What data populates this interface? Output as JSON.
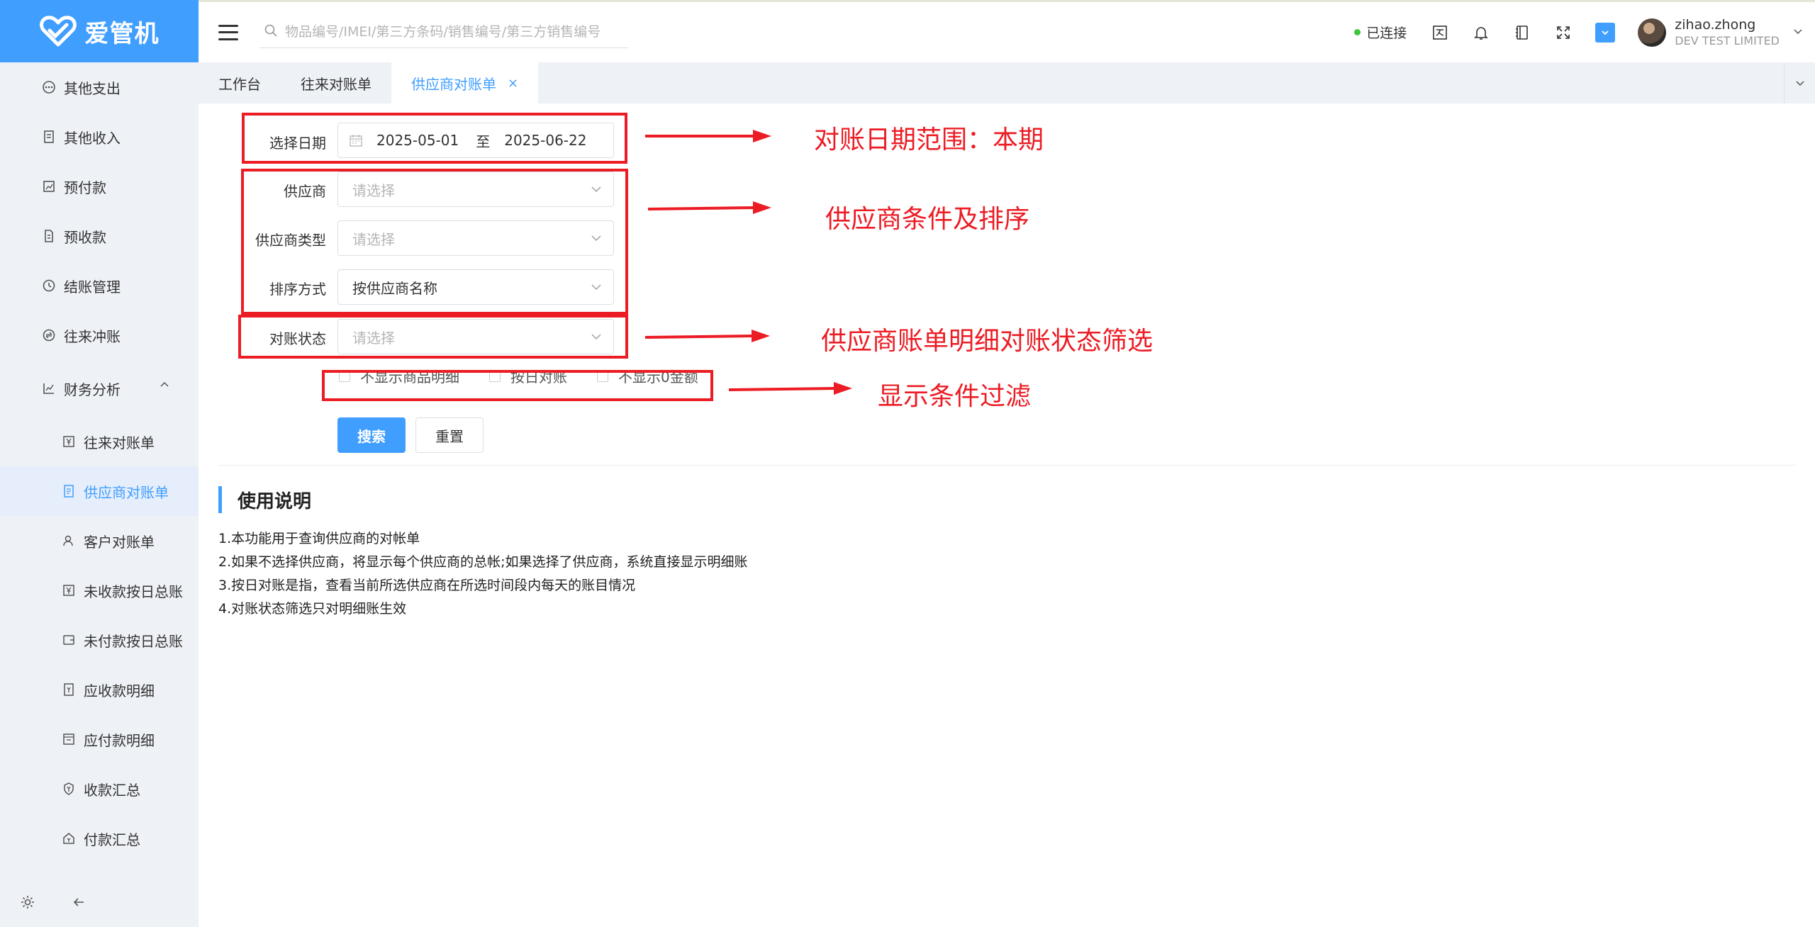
{
  "brand": {
    "name": "爱管机",
    "color": "#409eff"
  },
  "sidebar": {
    "items": [
      {
        "label": "其他支出",
        "icon": "ellipsis-circle-icon"
      },
      {
        "label": "其他收入",
        "icon": "receipt-icon"
      },
      {
        "label": "预付款",
        "icon": "chart-doc-icon"
      },
      {
        "label": "预收款",
        "icon": "document-icon"
      },
      {
        "label": "结账管理",
        "icon": "history-clock-icon"
      },
      {
        "label": "往来冲账",
        "icon": "exchange-icon"
      },
      {
        "label": "财务分析",
        "icon": "analysis-icon",
        "expanded": true
      }
    ],
    "sub_items": [
      {
        "label": "往来对账单",
        "icon": "yen-doc-icon"
      },
      {
        "label": "供应商对账单",
        "icon": "supplier-doc-icon",
        "active": true
      },
      {
        "label": "客户对账单",
        "icon": "customer-icon"
      },
      {
        "label": "未收款按日总账",
        "icon": "yen-doc-icon"
      },
      {
        "label": "未付款按日总账",
        "icon": "wallet-icon"
      },
      {
        "label": "应收款明细",
        "icon": "receivable-icon"
      },
      {
        "label": "应付款明细",
        "icon": "payable-icon"
      },
      {
        "label": "收款汇总",
        "icon": "collect-icon"
      },
      {
        "label": "付款汇总",
        "icon": "pay-icon"
      }
    ]
  },
  "header": {
    "search_placeholder": "物品编号/IMEI/第三方条码/销售编号/第三方销售编号",
    "connection_status": "已连接",
    "user_name": "zihao.zhong",
    "company": "DEV TEST LIMITED"
  },
  "tabs": [
    {
      "label": "工作台"
    },
    {
      "label": "往来对账单"
    },
    {
      "label": "供应商对账单",
      "active": true,
      "close": "×"
    }
  ],
  "form": {
    "date_label": "选择日期",
    "date_start": "2025-05-01",
    "date_separator": "至",
    "date_end": "2025-06-22",
    "supplier_label": "供应商",
    "supplier_placeholder": "请选择",
    "supplier_type_label": "供应商类型",
    "supplier_type_placeholder": "请选择",
    "sort_label": "排序方式",
    "sort_value": "按供应商名称",
    "status_label": "对账状态",
    "status_placeholder": "请选择",
    "check_hide_goods": "不显示商品明细",
    "check_by_day": "按日对账",
    "check_hide_zero": "不显示0金额",
    "search_button": "搜索",
    "reset_button": "重置"
  },
  "usage": {
    "title": "使用说明",
    "lines": [
      "1.本功能用于查询供应商的对帐单",
      "2.如果不选择供应商，将显示每个供应商的总帐;如果选择了供应商，系统直接显示明细账",
      "3.按日对账是指，查看当前所选供应商在所选时间段内每天的账目情况",
      "4.对账状态筛选只对明细账生效"
    ]
  },
  "annotations": {
    "color": "#ec1c24",
    "date_note": "对账日期范围：本期",
    "supplier_note": "供应商条件及排序",
    "status_note": "供应商账单明细对账状态筛选",
    "display_note": "显示条件过滤"
  }
}
